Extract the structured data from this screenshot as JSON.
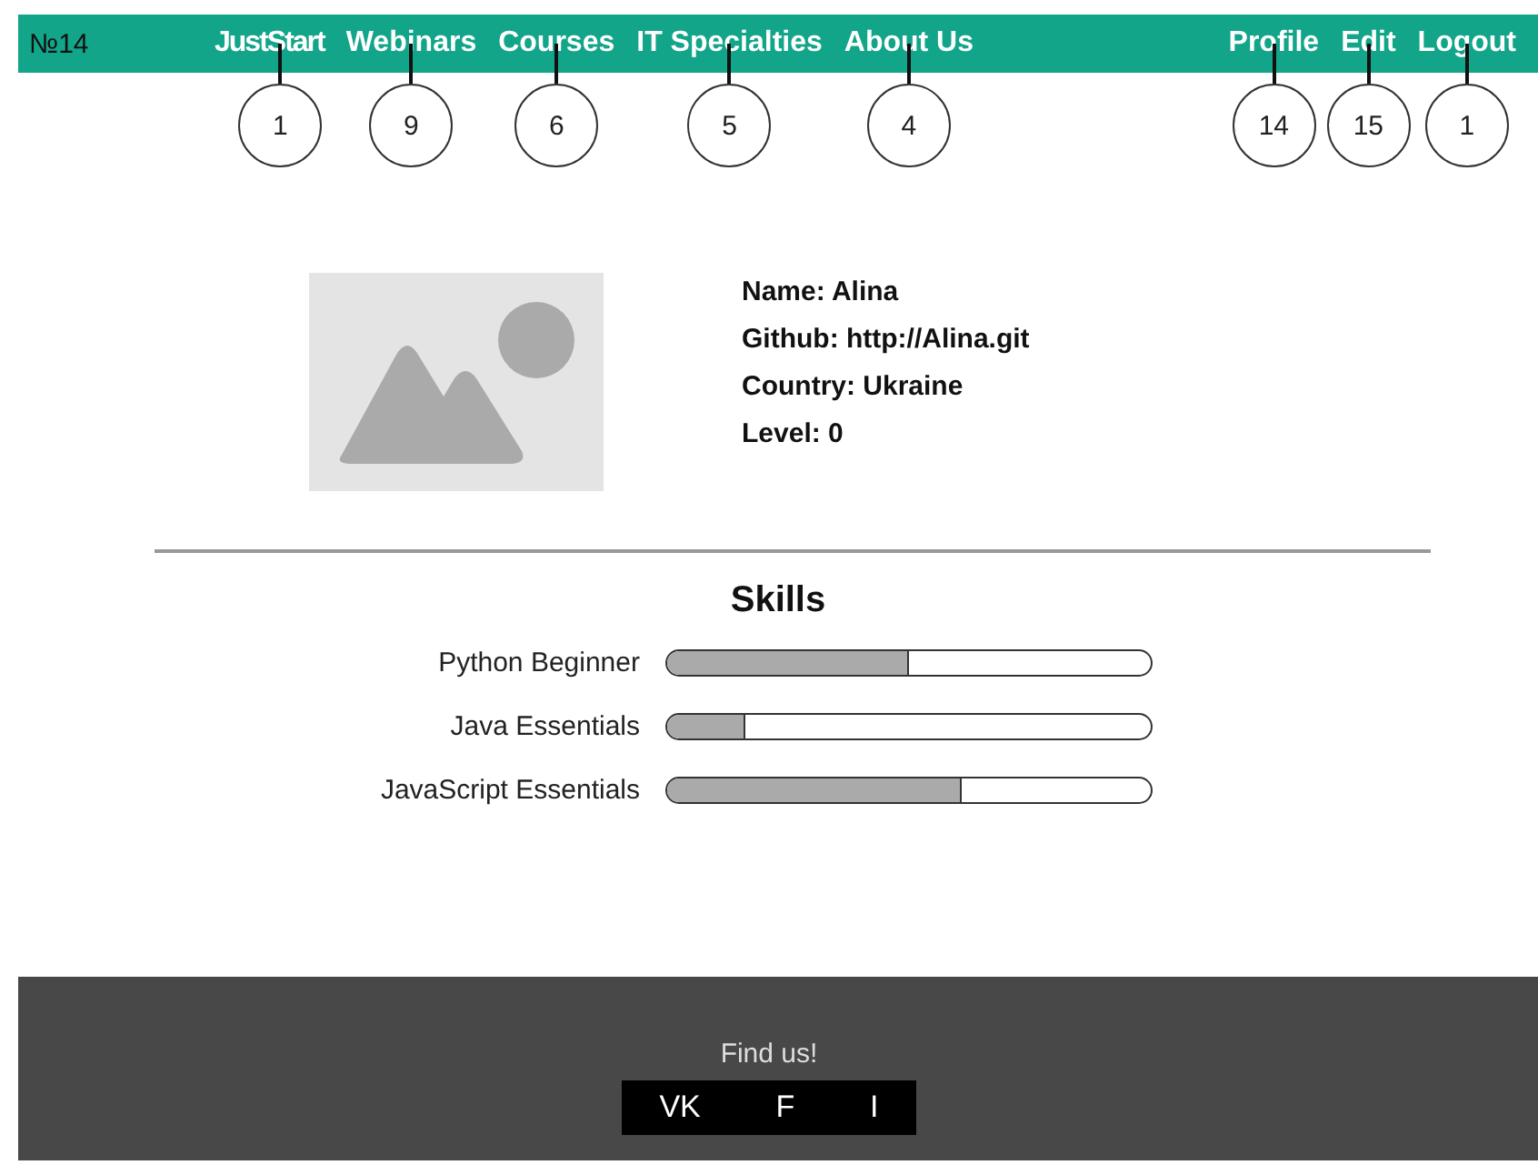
{
  "header": {
    "issue": "№14",
    "logo": "JustStart",
    "logo_callout": "1",
    "nav": [
      {
        "label": "Webinars",
        "callout": "9"
      },
      {
        "label": "Courses",
        "callout": "6"
      },
      {
        "label": "IT Specialties",
        "callout": "5"
      },
      {
        "label": "About Us",
        "callout": "4"
      }
    ],
    "user_nav": [
      {
        "label": "Profile",
        "callout": "14"
      },
      {
        "label": "Edit",
        "callout": "15"
      },
      {
        "label": "Logout",
        "callout": "1"
      }
    ]
  },
  "profile": {
    "fields": [
      "Name: Alina",
      "Github: http://Alina.git",
      "Country: Ukraine",
      "Level: 0"
    ]
  },
  "skills": {
    "title": "Skills",
    "items": [
      {
        "name": "Python Beginner",
        "level": 0.5
      },
      {
        "name": "Java Essentials",
        "level": 0.16
      },
      {
        "name": "JavaScript Essentials",
        "level": 0.61
      }
    ]
  },
  "footer": {
    "title": "Find us!",
    "links": [
      "VK",
      "F",
      "I"
    ]
  }
}
